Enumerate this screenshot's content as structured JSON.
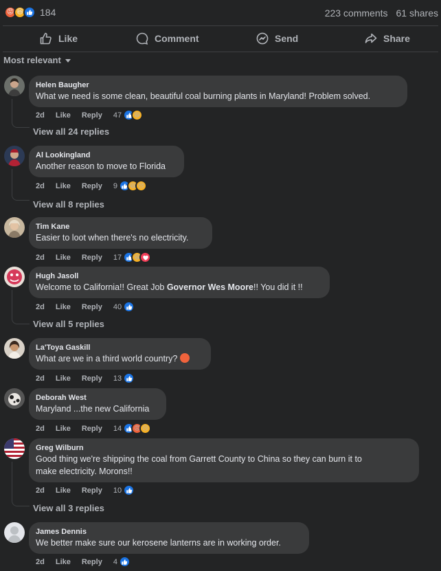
{
  "summary": {
    "reaction_count": "184",
    "comments": "223 comments",
    "shares": "61 shares"
  },
  "actions": {
    "like": "Like",
    "comment": "Comment",
    "send": "Send",
    "share": "Share"
  },
  "sort": {
    "label": "Most relevant"
  },
  "meta_labels": {
    "time": "2d",
    "like": "Like",
    "reply": "Reply"
  },
  "comments": [
    {
      "author": "Helen Baugher",
      "text": "What we need is some clean, beautiful coal burning plants in Maryland! Problem solved.",
      "count": "47",
      "view_replies": "View all 24 replies"
    },
    {
      "author": "Al Lookingland",
      "text": "Another reason to move to Florida",
      "count": "9",
      "view_replies": "View all 8 replies"
    },
    {
      "author": "Tim Kane",
      "text": "Easier to loot when there's no electricity.",
      "count": "17"
    },
    {
      "author": "Hugh Jasoll",
      "text_before": "Welcome to California!! Great Job ",
      "text_bold": "Governor Wes Moore",
      "text_after": "!! You did it !!",
      "count": "40",
      "view_replies": "View all 5 replies"
    },
    {
      "author": "La'Toya Gaskill",
      "text": "What are we in a third world country?",
      "count": "13"
    },
    {
      "author": "Deborah West",
      "text": "Maryland ...the new California",
      "count": "14"
    },
    {
      "author": "Greg Wilburn",
      "text_line1": "Good thing we're shipping the coal from Garrett County to China so they can burn it to",
      "text_line2": "make electricity. Morons!!",
      "count": "10",
      "view_replies": "View all 3 replies"
    },
    {
      "author": "James Dennis",
      "text": "We better make sure our kerosene lanterns are in working order.",
      "count": "4"
    }
  ],
  "colors": {
    "background": "#232425",
    "bubble": "#3a3b3c",
    "like_blue": "#1b74e4",
    "secondary_text": "#b0b3b8"
  }
}
